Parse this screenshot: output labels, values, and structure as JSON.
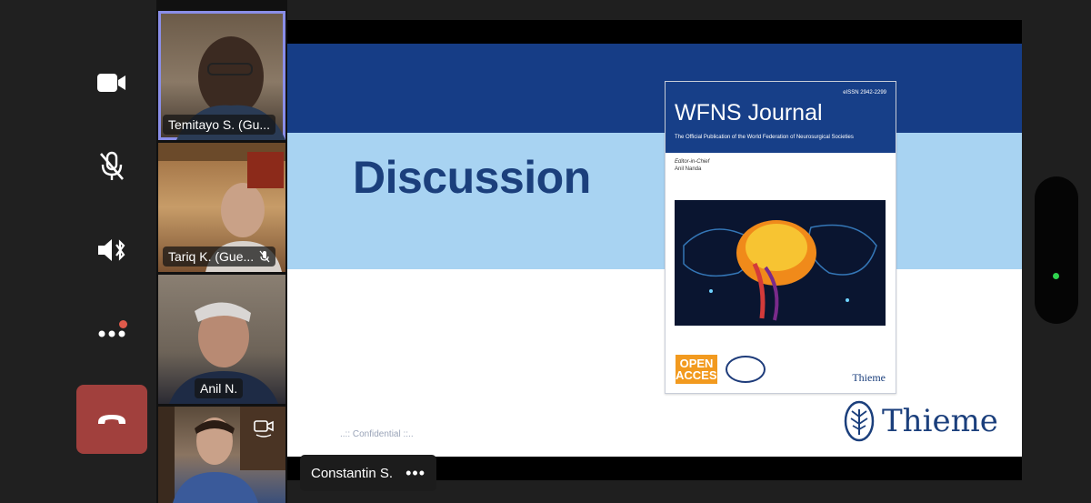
{
  "controls": {
    "camera_icon": "video-camera",
    "mic_icon": "microphone-muted",
    "speaker_icon": "speaker-bluetooth",
    "more_icon": "ellipsis",
    "end_icon": "phone-hangup",
    "end_color": "#a1403d",
    "badge_color": "#e05a4b"
  },
  "participants": [
    {
      "name": "Temitayo S. (Gu...",
      "muted": false,
      "active": true
    },
    {
      "name": "Tariq K. (Gue...",
      "muted": true,
      "active": false
    },
    {
      "name": "Anil N.",
      "muted": false,
      "active": false
    },
    {
      "name": "",
      "muted": false,
      "active": false
    }
  ],
  "slide": {
    "title": "Discussion",
    "confidential": "..:: Confidential ::..",
    "brand": "Thieme",
    "colors": {
      "dark_band": "#163d86",
      "light_band": "#a8d3f2",
      "title": "#1b3f7c"
    },
    "cover": {
      "issn": "eISSN 2942-2299",
      "title": "WFNS Journal",
      "subtitle": "The Official Publication of the World Federation of Neurosurgical Societies",
      "editor_label": "Editor-in-Chief",
      "editor_name": "Anil Nanda",
      "open_access_line1": "OPEN",
      "open_access_line2": "ACCESS",
      "brand": "Thieme"
    }
  },
  "presenter": {
    "name": "Constantin S.",
    "more_label": "•••"
  },
  "status": {
    "indicator_color": "#2fd34e"
  }
}
